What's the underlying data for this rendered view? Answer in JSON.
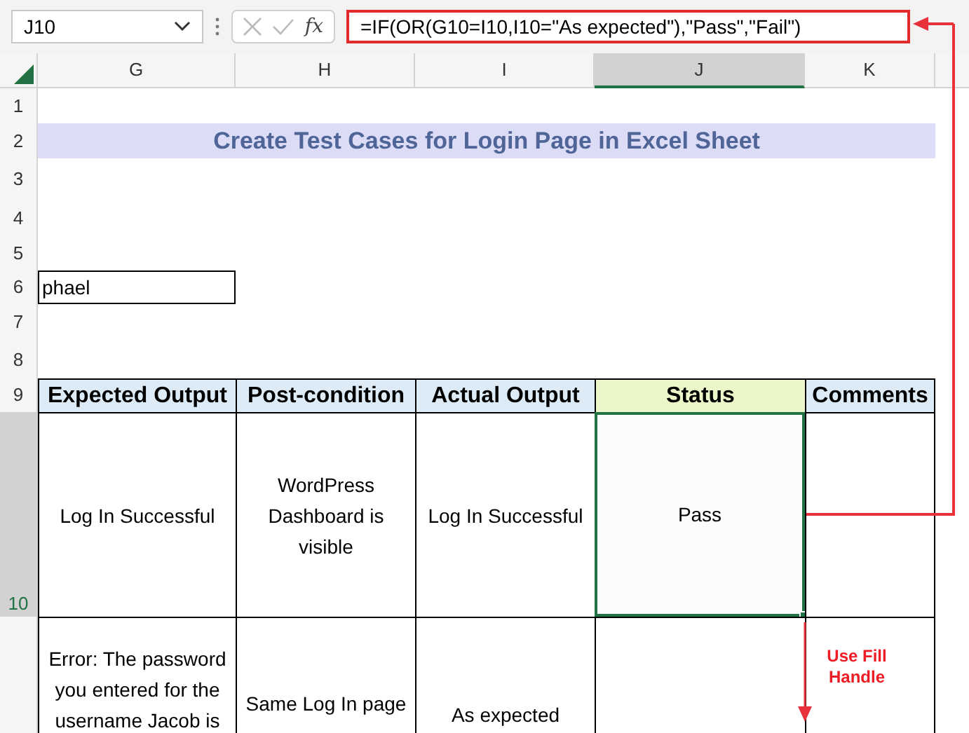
{
  "name_box": {
    "value": "J10"
  },
  "function_button": "fx",
  "formula_bar": {
    "value": "=IF(OR(G10=I10,I10=\"As expected\"),\"Pass\",\"Fail\")"
  },
  "columns": [
    {
      "label": "G",
      "selected": false
    },
    {
      "label": "H",
      "selected": false
    },
    {
      "label": "I",
      "selected": false
    },
    {
      "label": "J",
      "selected": true
    },
    {
      "label": "K",
      "selected": false
    }
  ],
  "rows": [
    {
      "label": "1",
      "selected": false
    },
    {
      "label": "2",
      "selected": false
    },
    {
      "label": "3",
      "selected": false
    },
    {
      "label": "4",
      "selected": false
    },
    {
      "label": "5",
      "selected": false
    },
    {
      "label": "6",
      "selected": false
    },
    {
      "label": "7",
      "selected": false
    },
    {
      "label": "8",
      "selected": false
    },
    {
      "label": "9",
      "selected": false
    },
    {
      "label": "10",
      "selected": true
    }
  ],
  "title": "Create Test Cases for Login Page in Excel Sheet",
  "name_cell": "phael",
  "table": {
    "columns": [
      {
        "label": "Expected Output",
        "color": "#ddebf7"
      },
      {
        "label": "Post-condition",
        "color": "#ddebf7"
      },
      {
        "label": "Actual Output",
        "color": "#ddebf7"
      },
      {
        "label": "Status",
        "color": "#ebf7c8"
      },
      {
        "label": "Comments",
        "color": "#ddebf7"
      }
    ],
    "rows": [
      {
        "cells": [
          {
            "text": "Log In Successful",
            "selected": false
          },
          {
            "text": "WordPress Dashboard is visible",
            "selected": false
          },
          {
            "text": "Log In Successful",
            "selected": false
          },
          {
            "text": "Pass",
            "selected": true
          },
          {
            "selected": false
          }
        ]
      },
      {
        "cells": [
          {
            "text": "Error: The password you entered for the username Jacob is",
            "selected": false
          },
          {
            "text": "Same Log In page",
            "selected": false
          },
          {
            "text": "As expected",
            "selected": false
          },
          {
            "selected": false
          },
          {
            "selected": false
          }
        ]
      }
    ]
  },
  "annotation": {
    "text": "Use Fill Handle"
  }
}
